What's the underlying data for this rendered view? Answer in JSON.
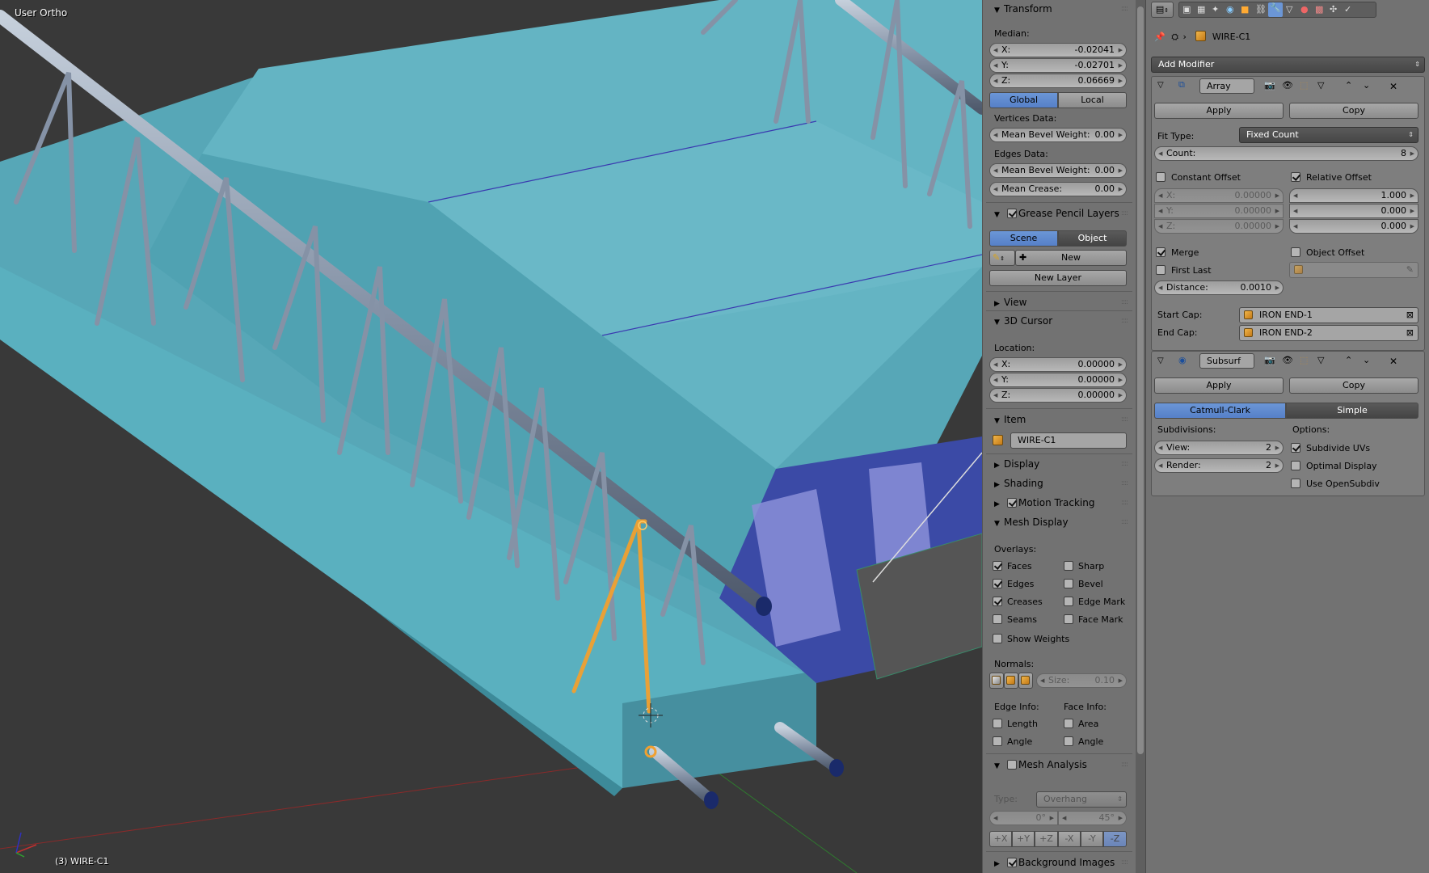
{
  "viewport": {
    "view_label": "User Ortho",
    "object_label": "(3) WIRE-C1"
  },
  "npanel": {
    "transform": {
      "title": "Transform",
      "median_label": "Median:",
      "x_label": "X:",
      "x_value": "-0.02041",
      "y_label": "Y:",
      "y_value": "-0.02701",
      "z_label": "Z:",
      "z_value": "0.06669",
      "global_label": "Global",
      "local_label": "Local",
      "vertices_data_label": "Vertices Data:",
      "mean_bevel_weight_label": "Mean Bevel Weight:",
      "vertices_bevel_value": "0.00",
      "edges_data_label": "Edges Data:",
      "edges_bevel_value": "0.00",
      "mean_crease_label": "Mean Crease:",
      "mean_crease_value": "0.00"
    },
    "grease_pencil": {
      "title": "Grease Pencil Layers",
      "scene_label": "Scene",
      "object_label": "Object",
      "new_label": "New",
      "new_layer_label": "New Layer"
    },
    "view_title": "View",
    "cursor": {
      "title": "3D Cursor",
      "location_label": "Location:",
      "x_label": "X:",
      "x_value": "0.00000",
      "y_label": "Y:",
      "y_value": "0.00000",
      "z_label": "Z:",
      "z_value": "0.00000"
    },
    "item": {
      "title": "Item",
      "name": "WIRE-C1"
    },
    "display_title": "Display",
    "shading_title": "Shading",
    "motion_tracking_title": "Motion Tracking",
    "mesh_display": {
      "title": "Mesh Display",
      "overlays_label": "Overlays:",
      "faces": "Faces",
      "sharp": "Sharp",
      "edges": "Edges",
      "bevel": "Bevel",
      "creases": "Creases",
      "edge_mark": "Edge Mark",
      "seams": "Seams",
      "face_mark": "Face Mark",
      "show_weights": "Show Weights",
      "normals_label": "Normals:",
      "size_label": "Size:",
      "size_value": "0.10",
      "edge_info_label": "Edge Info:",
      "face_info_label": "Face Info:",
      "length": "Length",
      "area": "Area",
      "angle_edge": "Angle",
      "angle_face": "Angle"
    },
    "mesh_analysis": {
      "title": "Mesh Analysis",
      "type_label": "Type:",
      "type_value": "Overhang",
      "min_value": "0°",
      "max_value": "45°",
      "axes": [
        "+X",
        "+Y",
        "+Z",
        "-X",
        "-Y",
        "-Z"
      ]
    },
    "background_images_title": "Background Images"
  },
  "props": {
    "object_name": "WIRE-C1",
    "add_modifier_label": "Add Modifier",
    "array": {
      "name": "Array",
      "apply_label": "Apply",
      "copy_label": "Copy",
      "fit_type_label": "Fit Type:",
      "fit_type_value": "Fixed Count",
      "count_label": "Count:",
      "count_value": "8",
      "constant_offset_label": "Constant Offset",
      "relative_offset_label": "Relative Offset",
      "const_x_label": "X:",
      "const_x_value": "0.00000",
      "const_y_label": "Y:",
      "const_y_value": "0.00000",
      "const_z_label": "Z:",
      "const_z_value": "0.00000",
      "rel_x_value": "1.000",
      "rel_y_value": "0.000",
      "rel_z_value": "0.000",
      "merge_label": "Merge",
      "object_offset_label": "Object Offset",
      "first_last_label": "First Last",
      "distance_label": "Distance:",
      "distance_value": "0.0010",
      "start_cap_label": "Start Cap:",
      "start_cap_value": "IRON END-1",
      "end_cap_label": "End Cap:",
      "end_cap_value": "IRON END-2"
    },
    "subsurf": {
      "name": "Subsurf",
      "apply_label": "Apply",
      "copy_label": "Copy",
      "catmull_label": "Catmull-Clark",
      "simple_label": "Simple",
      "subdivisions_label": "Subdivisions:",
      "options_label": "Options:",
      "view_label": "View:",
      "view_value": "2",
      "render_label": "Render:",
      "render_value": "2",
      "subdivide_uvs_label": "Subdivide UVs",
      "optimal_display_label": "Optimal Display",
      "use_opensubdiv_label": "Use OpenSubdiv"
    }
  }
}
